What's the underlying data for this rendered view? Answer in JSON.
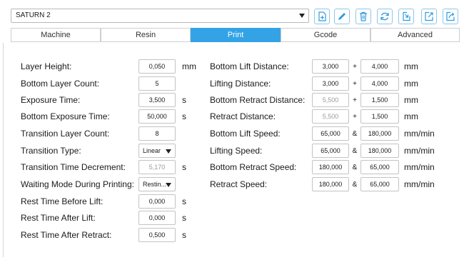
{
  "printer": {
    "selected": "SATURN 2"
  },
  "toolbar": [
    {
      "name": "add-profile-icon",
      "color": "#2e9be0"
    },
    {
      "name": "edit-icon",
      "color": "#2e9be0"
    },
    {
      "name": "delete-icon",
      "color": "#2e9be0"
    },
    {
      "name": "refresh-icon",
      "color": "#2e9be0"
    },
    {
      "name": "import-icon",
      "color": "#2e9be0"
    },
    {
      "name": "export-icon",
      "color": "#2e9be0"
    },
    {
      "name": "share-icon",
      "color": "#2e9be0"
    }
  ],
  "tabs": [
    {
      "label": "Machine",
      "active": false
    },
    {
      "label": "Resin",
      "active": false
    },
    {
      "label": "Print",
      "active": true
    },
    {
      "label": "Gcode",
      "active": false
    },
    {
      "label": "Advanced",
      "active": false
    }
  ],
  "accent_color": "#33a3e6",
  "left_fields": [
    {
      "label": "Layer Height:",
      "value": "0,050",
      "unit": "mm"
    },
    {
      "label": "Bottom Layer Count:",
      "value": "5",
      "unit": ""
    },
    {
      "label": "Exposure Time:",
      "value": "3,500",
      "unit": "s"
    },
    {
      "label": "Bottom Exposure Time:",
      "value": "50,000",
      "unit": "s"
    },
    {
      "label": "Transition Layer Count:",
      "value": "8",
      "unit": ""
    },
    {
      "label": "Transition Type:",
      "value": "Linear",
      "unit": ""
    },
    {
      "label": "Transition Time Decrement:",
      "value": "5,170",
      "unit": "s"
    },
    {
      "label": "Waiting Mode During Printing:",
      "value": "Restin...",
      "unit": ""
    },
    {
      "label": "Rest Time Before Lift:",
      "value": "0,000",
      "unit": "s"
    },
    {
      "label": "Rest Time After Lift:",
      "value": "0,000",
      "unit": "s"
    },
    {
      "label": "Rest Time After Retract:",
      "value": "0,500",
      "unit": "s"
    }
  ],
  "right_fields": [
    {
      "label": "Bottom Lift Distance:",
      "value1": "3,000",
      "op": "+",
      "value2": "4,000",
      "unit": "mm"
    },
    {
      "label": "Lifting Distance:",
      "value1": "3,000",
      "op": "+",
      "value2": "4,000",
      "unit": "mm"
    },
    {
      "label": "Bottom Retract Distance:",
      "value1": "5,500",
      "op": "+",
      "value2": "1,500",
      "unit": "mm"
    },
    {
      "label": "Retract Distance:",
      "value1": "5,500",
      "op": "+",
      "value2": "1,500",
      "unit": "mm"
    },
    {
      "label": "Bottom Lift Speed:",
      "value1": "65,000",
      "op": "&",
      "value2": "180,000",
      "unit": "mm/min"
    },
    {
      "label": "Lifting Speed:",
      "value1": "65,000",
      "op": "&",
      "value2": "180,000",
      "unit": "mm/min"
    },
    {
      "label": "Bottom Retract Speed:",
      "value1": "180,000",
      "op": "&",
      "value2": "65,000",
      "unit": "mm/min"
    },
    {
      "label": "Retract Speed:",
      "value1": "180,000",
      "op": "&",
      "value2": "65,000",
      "unit": "mm/min"
    }
  ]
}
